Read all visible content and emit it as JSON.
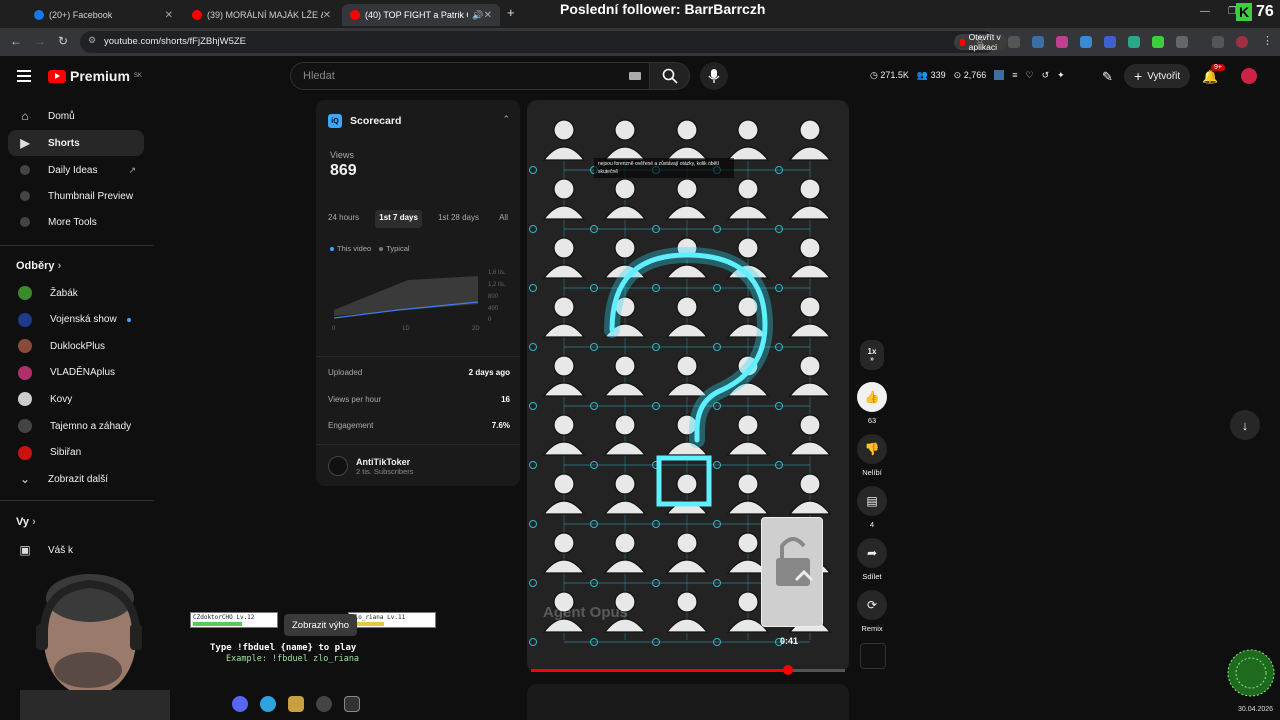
{
  "browser": {
    "tabs": [
      {
        "title": "(20+) Facebook",
        "favicon_color": "#1877f2"
      },
      {
        "title": "(39) MORÁLNÍ MAJÁK LŽE & Z/",
        "favicon_color": "#ff0000"
      },
      {
        "title": "(40) TOP FIGHT a Patrik Go",
        "favicon_color": "#ff0000"
      }
    ],
    "new_tab_label": "+",
    "url": "youtube.com/shorts/fFjZBhjW5ZE",
    "open_app_label": "Otevřít v aplikaci"
  },
  "stream": {
    "title": "Poslední follower: BarrBarrczh",
    "k_counter": "76",
    "tooltip": "Zobrazit výho",
    "players": [
      "CZdoktorCHO Lv.12",
      "zlo_riana Lv.11"
    ],
    "duel_line1": "Type !fbduel {name} to play",
    "duel_line2": "Example: !fbduel zlo_riana",
    "clock_date": "30.04.2026"
  },
  "masthead": {
    "logo": "Premium",
    "region": "SK",
    "search_placeholder": "Hledat",
    "stats": [
      "271.5K",
      "339",
      "2,766"
    ],
    "create_label": "Vytvořit",
    "notif_badge": "9+"
  },
  "sidebar": {
    "main": [
      {
        "label": "Domů",
        "icon": "home-icon"
      },
      {
        "label": "Shorts",
        "icon": "shorts-icon"
      }
    ],
    "tools": [
      "Daily Ideas",
      "Thumbnail Preview",
      "More Tools"
    ],
    "subscriptions_header": "Odběry",
    "channels": [
      {
        "label": "Žabák",
        "color": "#3a8a2a"
      },
      {
        "label": "Vojenská show",
        "color": "#1c3c8a"
      },
      {
        "label": "DuklockPlus",
        "color": "#8a4a3a"
      },
      {
        "label": "VLADĚNAplus",
        "color": "#b0306a"
      },
      {
        "label": "Kovy",
        "color": "#cccccc"
      },
      {
        "label": "Tajemno a záhady",
        "color": "#444444"
      },
      {
        "label": "Sibiřan",
        "color": "#cc1111"
      }
    ],
    "show_more": "Zobrazit další",
    "you_header": "Vy",
    "you_first": "Váš k"
  },
  "scorecard": {
    "title": "Scorecard",
    "views_label": "Views",
    "views_value": "869",
    "tabs": [
      "24 hours",
      "1st 7 days",
      "1st 28 days",
      "All"
    ],
    "active_tab": 1,
    "legend": [
      "This video",
      "Typical"
    ],
    "y_ticks": [
      "1,6 tis.",
      "1,2 tis.",
      "800",
      "400",
      "0"
    ],
    "x_ticks": [
      "0",
      "1D",
      "2D"
    ],
    "rows": [
      {
        "label": "Uploaded",
        "value": "2 days ago"
      },
      {
        "label": "Views per hour",
        "value": "16"
      },
      {
        "label": "Engagement",
        "value": "7.6%"
      }
    ],
    "channel_name": "AntiTikToker",
    "channel_subs": "2 tis. Subscribers"
  },
  "video": {
    "caption": "nejsou forenzně ověřené a zůstávají otázky, kolik obětí skutečně",
    "watermark": "Agent Opus",
    "timestamp": "0:41",
    "progress_fraction": 0.82
  },
  "actions": {
    "speed": "1x",
    "like_count": "63",
    "dislike_label": "Nelíbí",
    "comment_count": "4",
    "share_label": "Sdílet",
    "remix_label": "Remix"
  }
}
